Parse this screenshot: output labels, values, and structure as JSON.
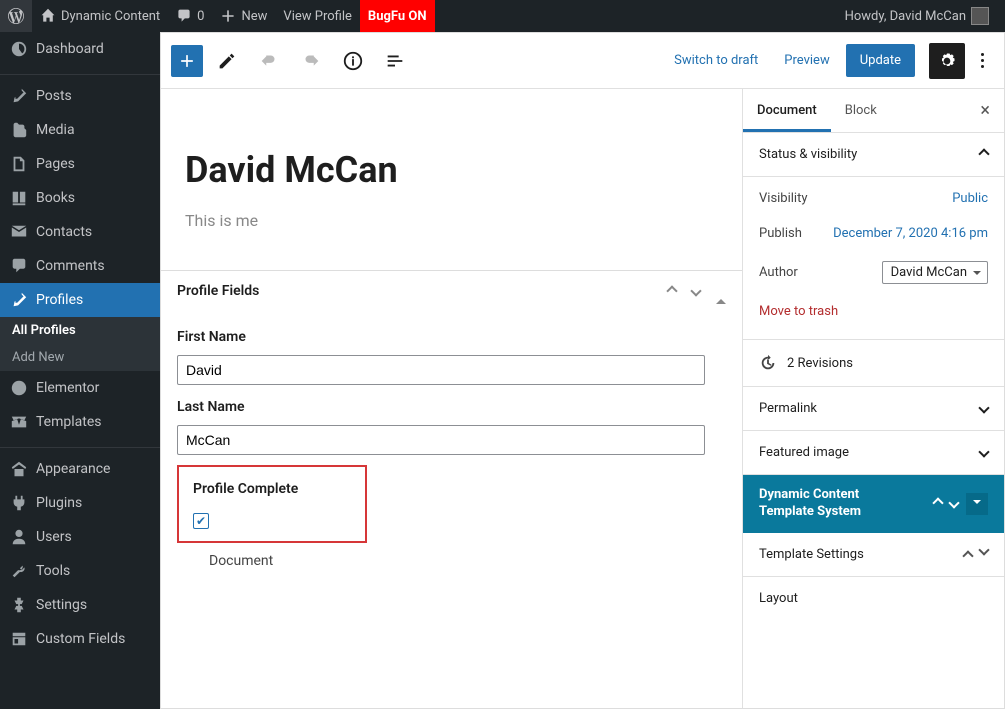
{
  "adminbar": {
    "site_name": "Dynamic Content",
    "comment_count": "0",
    "new_label": "New",
    "view_profile": "View Profile",
    "bugfu": "BugFu ON",
    "howdy": "Howdy, David McCan"
  },
  "sidebar": {
    "dashboard": "Dashboard",
    "posts": "Posts",
    "media": "Media",
    "pages": "Pages",
    "books": "Books",
    "contacts": "Contacts",
    "comments": "Comments",
    "profiles": "Profiles",
    "all_profiles": "All Profiles",
    "add_new": "Add New",
    "elementor": "Elementor",
    "templates": "Templates",
    "appearance": "Appearance",
    "plugins": "Plugins",
    "users": "Users",
    "tools": "Tools",
    "settings": "Settings",
    "custom_fields": "Custom Fields"
  },
  "toolbar": {
    "switch_draft": "Switch to draft",
    "preview": "Preview",
    "update": "Update"
  },
  "doc": {
    "title": "David McCan",
    "content": "This is me"
  },
  "metabox": {
    "title": "Profile Fields",
    "first_name_label": "First Name",
    "first_name_value": "David",
    "last_name_label": "Last Name",
    "last_name_value": "McCan",
    "complete_label": "Profile Complete",
    "doc_tab": "Document"
  },
  "panel": {
    "tab_document": "Document",
    "tab_block": "Block",
    "status_vis": "Status & visibility",
    "visibility_label": "Visibility",
    "visibility_value": "Public",
    "publish_label": "Publish",
    "publish_value": "December 7, 2020 4:16 pm",
    "author_label": "Author",
    "author_value": "David McCan",
    "trash": "Move to trash",
    "revisions": "2 Revisions",
    "permalink": "Permalink",
    "featured": "Featured image",
    "dc_title1": "Dynamic Content",
    "dc_title2": "Template System",
    "template_settings": "Template Settings",
    "layout": "Layout"
  }
}
